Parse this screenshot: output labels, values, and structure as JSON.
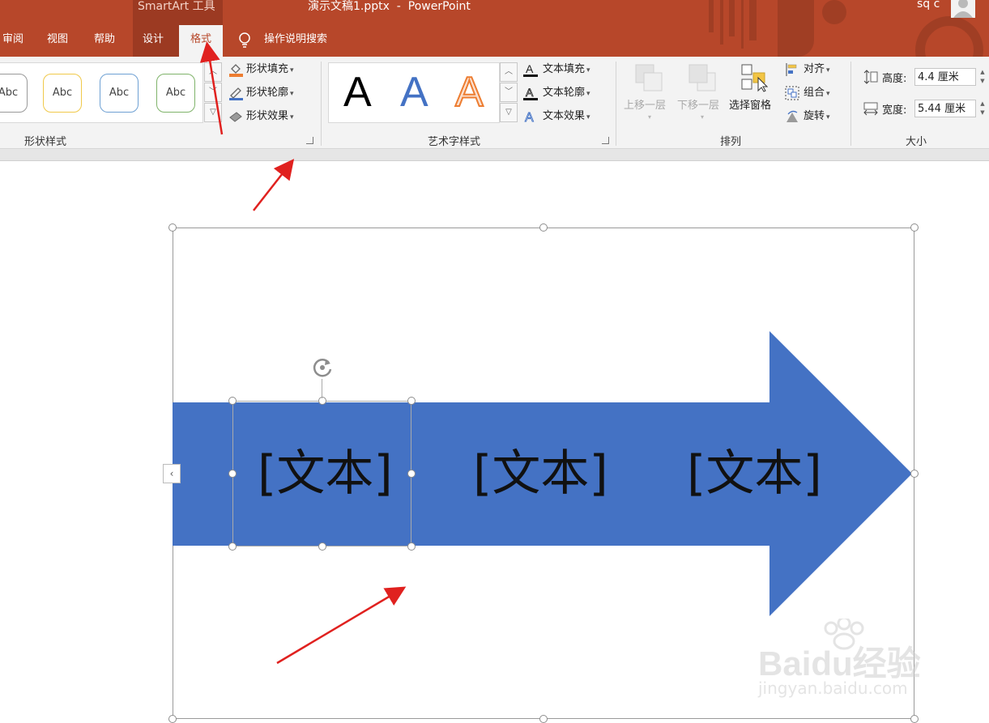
{
  "titlebar": {
    "context_tab_group": "SmartArt 工具",
    "document_title": "演示文稿1.pptx  -  PowerPoint",
    "user_name": "sq c"
  },
  "tabs": {
    "review": "审阅",
    "view": "视图",
    "help": "帮助",
    "design": "设计",
    "format": "格式",
    "tell_me": "操作说明搜索"
  },
  "shape_styles": {
    "swatch_label": "Abc",
    "fill": "形状填充",
    "outline": "形状轮廓",
    "effects": "形状效果",
    "group_label": "形状样式"
  },
  "wordart_styles": {
    "letter": "A",
    "text_fill": "文本填充",
    "text_outline": "文本轮廓",
    "text_effects": "文本效果",
    "group_label": "艺术字样式"
  },
  "arrange": {
    "bring_forward": "上移一层",
    "send_backward": "下移一层",
    "selection_pane": "选择窗格",
    "align": "对齐",
    "group": "组合",
    "rotate": "旋转",
    "group_label": "排列"
  },
  "size": {
    "height_label": "高度:",
    "height_value": "4.4 厘米",
    "width_label": "宽度:",
    "width_value": "5.44 厘米",
    "group_label": "大小"
  },
  "smartart": {
    "nodes": [
      "[文本]",
      "[文本]",
      "[文本]"
    ]
  },
  "watermark": {
    "logo": "Baidu经验",
    "url": "jingyan.baidu.com"
  },
  "colors": {
    "title_bar": "#b7472a",
    "ribbon": "#f3f3f3",
    "arrow_fill": "#4472c4",
    "annotation_arrow": "#e0211f"
  }
}
